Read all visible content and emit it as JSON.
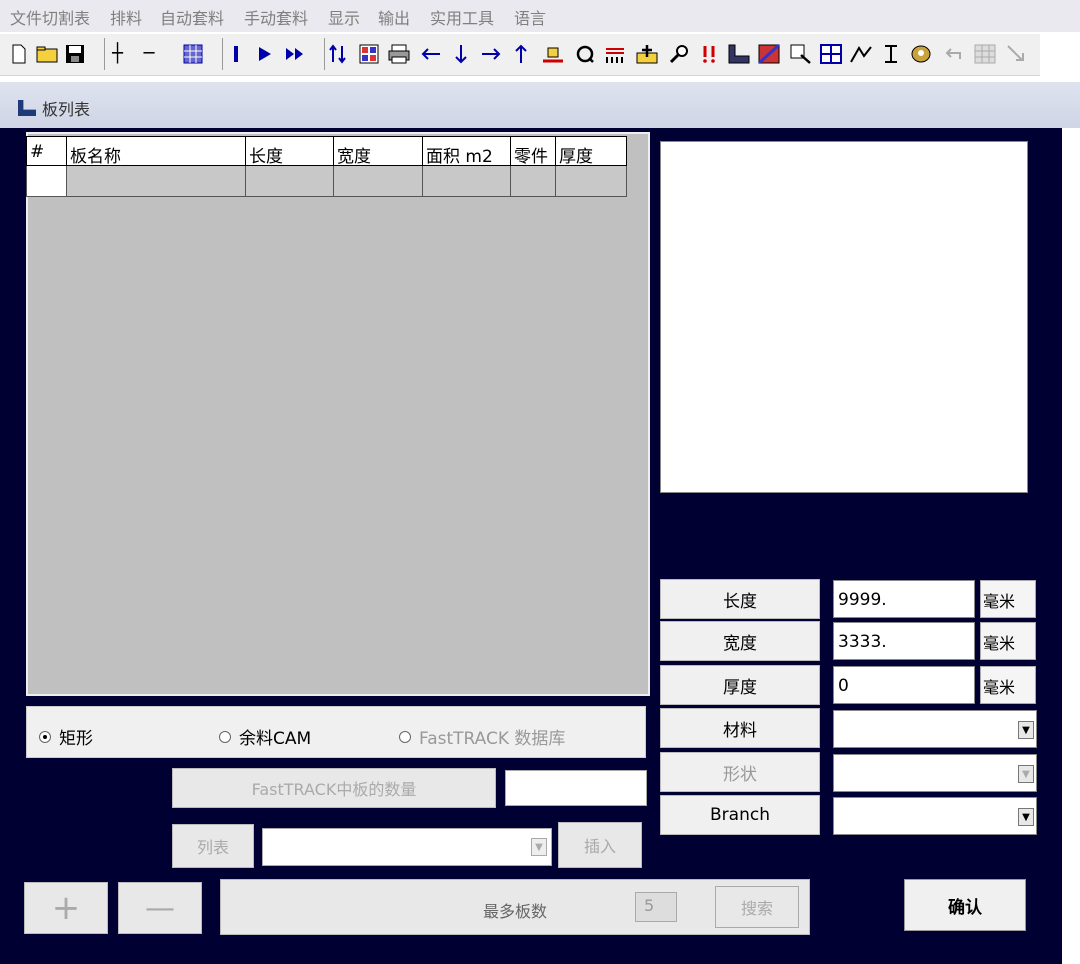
{
  "menu": [
    "文件切割表",
    "排料",
    "自动套料",
    "手动套料",
    "显示",
    "输出",
    "实用工具",
    "语言"
  ],
  "toolbar_icons": [
    "new-file-icon",
    "open-folder-icon",
    "save-icon",
    "plus-icon",
    "minus-icon",
    "grid-icon",
    "pause-icon",
    "play-icon",
    "fast-forward-icon",
    "sort-icon",
    "nest-pattern-icon",
    "print-icon",
    "arrow-left-icon",
    "arrow-down-icon",
    "arrow-right-icon",
    "arrow-up-icon",
    "align-bottom-icon",
    "rotate-icon",
    "red-bars-icon",
    "add-to-plate-icon",
    "key-icon",
    "warning-icon",
    "sheet-icon",
    "red-sheet-icon",
    "zoom-window-icon",
    "zoom-all-icon",
    "draw-line-icon",
    "text-cursor-icon",
    "color-icon",
    "undo-icon",
    "grid-disabled-icon",
    "corner-disabled-icon"
  ],
  "panel": {
    "title": "板列表"
  },
  "table": {
    "columns": [
      "#",
      "板名称",
      "长度",
      "宽度",
      "面积   m2",
      "零件",
      "厚度"
    ],
    "rows": [
      [
        "",
        "",
        "",
        "",
        "",
        "",
        ""
      ]
    ]
  },
  "props": {
    "length": {
      "label": "长度",
      "value": "9999.",
      "unit": "毫米"
    },
    "width": {
      "label": "宽度",
      "value": "3333.",
      "unit": "毫米"
    },
    "thickness": {
      "label": "厚度",
      "value": "0",
      "unit": "毫米"
    },
    "material": {
      "label": "材料",
      "value": ""
    },
    "shape": {
      "label": "形状",
      "value": ""
    },
    "branch": {
      "label": "Branch",
      "value": ""
    }
  },
  "source": {
    "options": [
      {
        "label": "矩形",
        "selected": true,
        "enabled": true
      },
      {
        "label": "余料CAM",
        "selected": false,
        "enabled": true
      },
      {
        "label": "FastTRACK 数据库",
        "selected": false,
        "enabled": false
      }
    ],
    "fasttrack_count_label": "FastTRACK中板的数量",
    "fasttrack_count_value": ""
  },
  "list": {
    "button": "列表",
    "selected": "",
    "insert": "插入"
  },
  "bottom": {
    "add_symbol": "+",
    "remove_symbol": "—",
    "max_plates_label": "最多板数",
    "max_plates_value": "5",
    "search": "搜索",
    "confirm": "确认"
  }
}
